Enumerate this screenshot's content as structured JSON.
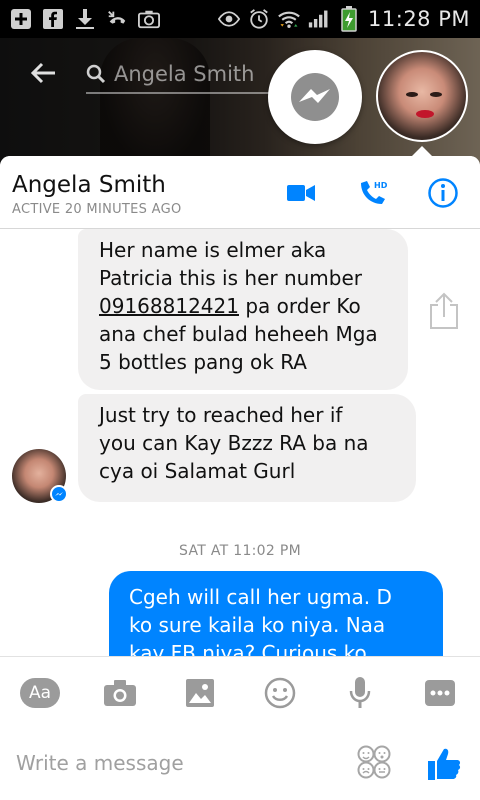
{
  "status_bar": {
    "time": "11:28 PM",
    "left_icons": [
      "add-icon",
      "facebook-icon",
      "download-icon",
      "missed-call-icon",
      "camera-icon"
    ],
    "right_icons": [
      "eye-icon",
      "alarm-icon",
      "wifi-icon",
      "signal-icon",
      "battery-icon"
    ]
  },
  "header": {
    "search_text": "Angela Smith"
  },
  "contact": {
    "name": "Angela Smith",
    "status": "ACTIVE 20 MINUTES AGO"
  },
  "header_actions": [
    "video-call-icon",
    "hd-call-icon",
    "info-icon"
  ],
  "messages": [
    {
      "direction": "incoming",
      "lines": [
        "Her name is elmer aka",
        "Patricia this is her number"
      ],
      "phone": "09168812421",
      "after_phone": " pa order Ko",
      "more_lines": [
        "ana chef bulad heheeh Mga",
        "5 bottles pang ok RA"
      ]
    },
    {
      "direction": "incoming",
      "lines": [
        "Just try to reached her if",
        "you can Kay Bzzz RA ba na",
        "cya oi Salamat Gurl"
      ]
    }
  ],
  "timestamp": "SAT AT 11:02 PM",
  "outgoing_message": {
    "lines": [
      "Cgeh will call her ugma. D",
      "ko sure kaila ko niya. Naa",
      "kay FB niya? Curious ko"
    ]
  },
  "toolbar": {
    "text_tool_label": "Aa",
    "icons": [
      "camera-icon",
      "gallery-icon",
      "emoji-icon",
      "microphone-icon",
      "more-icon"
    ]
  },
  "composer": {
    "placeholder": "Write a message"
  },
  "colors": {
    "accent": "#0084ff",
    "incoming_bubble": "#f1f0f0",
    "icon_gray": "#9b9b9b"
  }
}
